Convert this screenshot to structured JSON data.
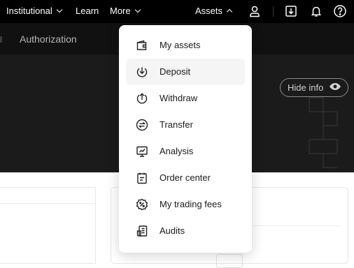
{
  "topnav": {
    "institutional": "Institutional",
    "learn": "Learn",
    "more": "More",
    "assets": "Assets"
  },
  "subnav": {
    "tab": "Authorization"
  },
  "hero": {
    "hide_info": "Hide info"
  },
  "assets_menu": {
    "items": [
      {
        "label": "My assets",
        "icon": "wallet-icon"
      },
      {
        "label": "Deposit",
        "icon": "deposit-icon"
      },
      {
        "label": "Withdraw",
        "icon": "withdraw-icon"
      },
      {
        "label": "Transfer",
        "icon": "transfer-icon"
      },
      {
        "label": "Analysis",
        "icon": "analysis-icon"
      },
      {
        "label": "Order center",
        "icon": "order-center-icon"
      },
      {
        "label": "My trading fees",
        "icon": "trading-fees-icon"
      },
      {
        "label": "Audits",
        "icon": "audits-icon"
      }
    ],
    "hovered": "Deposit"
  },
  "colors": {
    "topbar": "#000000",
    "subbar": "#111111",
    "hero": "#1b1b1b",
    "menu_hover": "#f5f5f5"
  }
}
